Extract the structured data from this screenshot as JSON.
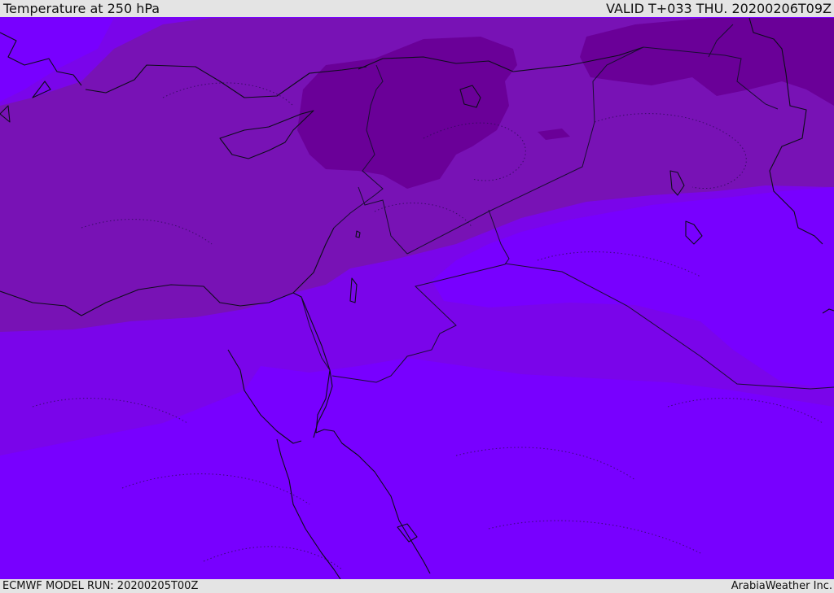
{
  "header": {
    "title": "Temperature at 250 hPa",
    "valid_time": "VALID T+033 THU. 20200206T09Z"
  },
  "footer": {
    "model_run": "ECMWF MODEL RUN: 20200205T00Z",
    "credit": "ArabiaWeather Inc."
  },
  "colors": {
    "temp_band_warmest": "#7800ff",
    "temp_band_mid": "#7a05ea",
    "temp_band_cool": "#7812b5",
    "temp_band_coldest": "#6a0098",
    "coastline": "#0d0d1a"
  }
}
